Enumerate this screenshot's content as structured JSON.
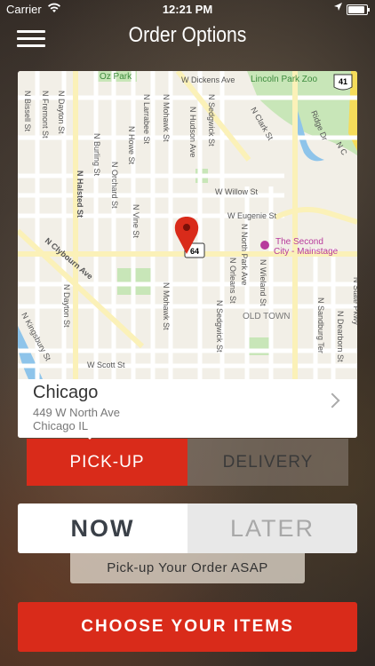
{
  "status_bar": {
    "carrier": "Carrier",
    "time": "12:21 PM",
    "wifi_icon": "wifi-icon",
    "location_icon": "location-arrow-icon",
    "battery_level": 0.9
  },
  "header": {
    "title": "Order Options",
    "menu_icon": "hamburger-menu-icon"
  },
  "map": {
    "labels": {
      "oz_park": "Oz Park",
      "dickens": "W Dickens Ave",
      "lincoln_zoo": "Lincoln Park Zoo",
      "hwy41": "41",
      "bissell": "N Bissell St",
      "fremont": "N Fremont St",
      "dayton": "N Dayton St",
      "dayton2": "N Dayton St",
      "halsted": "N Halsted St",
      "burling": "N Burling St",
      "orchard": "N Orchard St",
      "larrabee": "N Larrabee St",
      "howe": "N Howe St",
      "vine": "N Vine St",
      "mohawk": "N Mohawk St",
      "mohawk2": "N Mohawk St",
      "sedgwick": "N Sedgwick St",
      "sedgwick2": "N Sedgwick St",
      "hudson": "N Hudson Ave",
      "clark": "N Clark St",
      "ridge": "Ridge Dr",
      "nc": "N C",
      "willow": "W Willow St",
      "eugenie": "W Eugenie St",
      "hwy64": "64",
      "second_city_1": "The Second",
      "second_city_2": "City - Mainstage",
      "north_park": "N North Park Ave",
      "wieland": "N Wieland St",
      "orleans": "N Orleans St",
      "old_town": "OLD TOWN",
      "clybourn": "N Clybourn Ave",
      "kingsbury": "N Kingsbury St",
      "sandburg": "N Sandburg Ter",
      "dearborn": "N Dearborn St",
      "state": "N State Pkwy",
      "scott": "W Scott St"
    }
  },
  "location": {
    "city": "Chicago",
    "address": "449 W North Ave",
    "state": "Chicago IL",
    "chevron_icon": "chevron-right-icon"
  },
  "order_type": {
    "pickup_label": "PICK-UP",
    "delivery_label": "DELIVERY",
    "selected": "pickup"
  },
  "timing": {
    "now_label": "NOW",
    "later_label": "LATER",
    "selected": "now",
    "note": "Pick-up Your Order ASAP"
  },
  "cta": {
    "label": "CHOOSE YOUR ITEMS"
  },
  "colors": {
    "accent_red": "#d92b1a",
    "map_park_green": "#c8e6b8",
    "map_water": "#8ec4ea",
    "map_highway": "#f5dc5a"
  }
}
